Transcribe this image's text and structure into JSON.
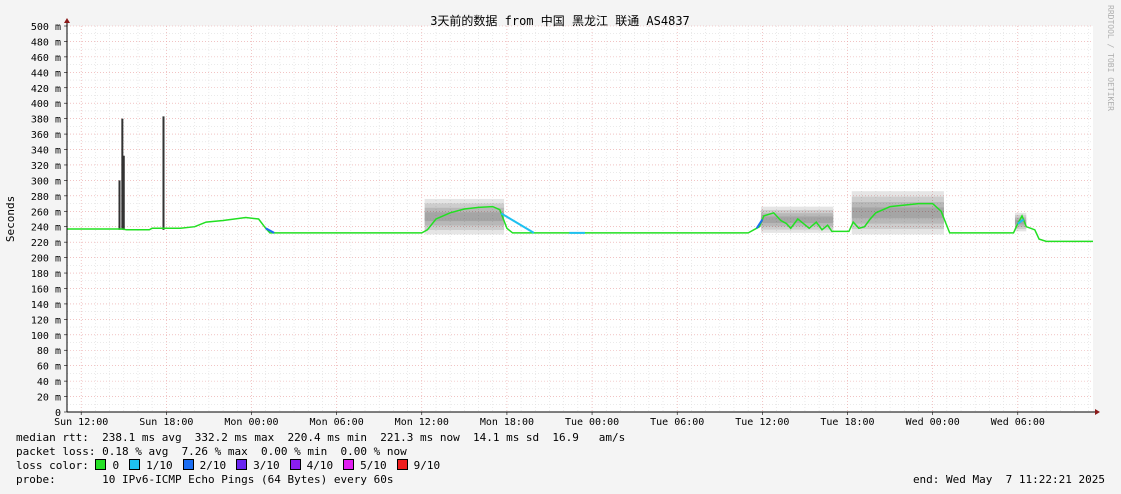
{
  "chart_data": {
    "type": "line",
    "title": "3天前的数据 from 中国 黑龙江 联通 AS4837",
    "ylabel": "Seconds",
    "xlabel": "",
    "watermark": "RRDTOOL / TOBI OETIKER",
    "ylim": [
      0,
      500
    ],
    "yticks": [
      {
        "v": 0,
        "label": "0"
      },
      {
        "v": 20,
        "label": "20 m"
      },
      {
        "v": 40,
        "label": "40 m"
      },
      {
        "v": 60,
        "label": "60 m"
      },
      {
        "v": 80,
        "label": "80 m"
      },
      {
        "v": 100,
        "label": "100 m"
      },
      {
        "v": 120,
        "label": "120 m"
      },
      {
        "v": 140,
        "label": "140 m"
      },
      {
        "v": 160,
        "label": "160 m"
      },
      {
        "v": 180,
        "label": "180 m"
      },
      {
        "v": 200,
        "label": "200 m"
      },
      {
        "v": 220,
        "label": "220 m"
      },
      {
        "v": 240,
        "label": "240 m"
      },
      {
        "v": 260,
        "label": "260 m"
      },
      {
        "v": 280,
        "label": "280 m"
      },
      {
        "v": 300,
        "label": "300 m"
      },
      {
        "v": 320,
        "label": "320 m"
      },
      {
        "v": 340,
        "label": "340 m"
      },
      {
        "v": 360,
        "label": "360 m"
      },
      {
        "v": 380,
        "label": "380 m"
      },
      {
        "v": 400,
        "label": "400 m"
      },
      {
        "v": 420,
        "label": "420 m"
      },
      {
        "v": 440,
        "label": "440 m"
      },
      {
        "v": 460,
        "label": "460 m"
      },
      {
        "v": 480,
        "label": "480 m"
      },
      {
        "v": 500,
        "label": "500 m"
      }
    ],
    "x_range_hours": [
      -1.0,
      71.3
    ],
    "xticks": [
      {
        "h": 0,
        "label": "Sun 12:00"
      },
      {
        "h": 6,
        "label": "Sun 18:00"
      },
      {
        "h": 12,
        "label": "Mon 00:00"
      },
      {
        "h": 18,
        "label": "Mon 06:00"
      },
      {
        "h": 24,
        "label": "Mon 12:00"
      },
      {
        "h": 30,
        "label": "Mon 18:00"
      },
      {
        "h": 36,
        "label": "Tue 00:00"
      },
      {
        "h": 42,
        "label": "Tue 06:00"
      },
      {
        "h": 48,
        "label": "Tue 12:00"
      },
      {
        "h": 54,
        "label": "Tue 18:00"
      },
      {
        "h": 60,
        "label": "Wed 00:00"
      },
      {
        "h": 66,
        "label": "Wed 06:00"
      }
    ],
    "series": [
      {
        "name": "median rtt",
        "color": "#22e022",
        "points": [
          [
            -1.0,
            237
          ],
          [
            1.4,
            237
          ],
          [
            2.9,
            237
          ],
          [
            3.2,
            236
          ],
          [
            4.8,
            236
          ],
          [
            5.0,
            238
          ],
          [
            7.0,
            238
          ],
          [
            8.0,
            240
          ],
          [
            8.8,
            246
          ],
          [
            10.0,
            248
          ],
          [
            11.6,
            252
          ],
          [
            12.5,
            250
          ],
          [
            13.0,
            238
          ],
          [
            13.3,
            232
          ],
          [
            24.0,
            232
          ],
          [
            24.4,
            236
          ],
          [
            25.0,
            250
          ],
          [
            26.0,
            258
          ],
          [
            27.0,
            263
          ],
          [
            28.0,
            265
          ],
          [
            29.0,
            266
          ],
          [
            29.5,
            262
          ],
          [
            30.0,
            238
          ],
          [
            30.4,
            232
          ],
          [
            47.0,
            232
          ],
          [
            47.8,
            240
          ],
          [
            48.1,
            254
          ],
          [
            48.8,
            258
          ],
          [
            49.3,
            248
          ],
          [
            49.7,
            244
          ],
          [
            50.0,
            238
          ],
          [
            50.5,
            250
          ],
          [
            50.9,
            244
          ],
          [
            51.3,
            238
          ],
          [
            51.8,
            246
          ],
          [
            52.2,
            236
          ],
          [
            52.6,
            242
          ],
          [
            52.9,
            234
          ],
          [
            54.1,
            234
          ],
          [
            54.4,
            246
          ],
          [
            54.8,
            238
          ],
          [
            55.2,
            240
          ],
          [
            55.6,
            250
          ],
          [
            56.0,
            258
          ],
          [
            57.0,
            266
          ],
          [
            58.0,
            268
          ],
          [
            59.0,
            270
          ],
          [
            60.0,
            270
          ],
          [
            60.6,
            260
          ],
          [
            60.9,
            246
          ],
          [
            61.2,
            232
          ],
          [
            65.7,
            232
          ],
          [
            66.0,
            244
          ],
          [
            66.3,
            254
          ],
          [
            66.6,
            240
          ],
          [
            67.2,
            236
          ],
          [
            67.5,
            224
          ],
          [
            68.0,
            221
          ],
          [
            71.3,
            221
          ]
        ]
      }
    ],
    "spikes": [
      {
        "h": 2.9,
        "v": 380
      },
      {
        "h": 3.0,
        "v": 332
      },
      {
        "h": 2.7,
        "v": 300
      },
      {
        "h": 5.8,
        "v": 383
      },
      {
        "h": 5.8,
        "v": 355
      }
    ],
    "smoke_bands": [
      {
        "from_h": 24.2,
        "to_h": 29.8,
        "low": 230,
        "high": 276
      },
      {
        "from_h": 47.9,
        "to_h": 53.0,
        "low": 232,
        "high": 266
      },
      {
        "from_h": 54.3,
        "to_h": 60.8,
        "low": 230,
        "high": 286
      },
      {
        "from_h": 65.8,
        "to_h": 66.6,
        "low": 234,
        "high": 258
      }
    ],
    "loss_segments": [
      {
        "from_h": 13.0,
        "to_h": 13.6,
        "color": "#1c6ef2"
      },
      {
        "from_h": 29.6,
        "to_h": 31.9,
        "color": "#1ec0f0"
      },
      {
        "from_h": 34.4,
        "to_h": 35.5,
        "color": "#1ec0f0"
      },
      {
        "from_h": 47.6,
        "to_h": 48.0,
        "color": "#1c6ef2"
      },
      {
        "from_h": 66.0,
        "to_h": 66.4,
        "color": "#1ec0f0"
      }
    ]
  },
  "stats": {
    "median_rtt": "median rtt:  238.1 ms avg  332.2 ms max  220.4 ms min  221.3 ms now  14.1 ms sd  16.9   am/s",
    "packet_loss": "packet loss: 0.18 % avg  7.26 % max  0.00 % min  0.00 % now",
    "loss_color_label": "loss color: ",
    "probe": "probe:       10 IPv6-ICMP Echo Pings (64 Bytes) every 60s",
    "end": "end: Wed May  7 11:22:21 2025"
  },
  "loss_colors": [
    {
      "label": "0",
      "color": "#26e026"
    },
    {
      "label": "1/10",
      "color": "#1ec0f0"
    },
    {
      "label": "2/10",
      "color": "#1c6ef2"
    },
    {
      "label": "3/10",
      "color": "#6a26f0"
    },
    {
      "label": "4/10",
      "color": "#8a1ef0"
    },
    {
      "label": "5/10",
      "color": "#e01ef0"
    },
    {
      "label": "9/10",
      "color": "#f01e1e"
    }
  ]
}
